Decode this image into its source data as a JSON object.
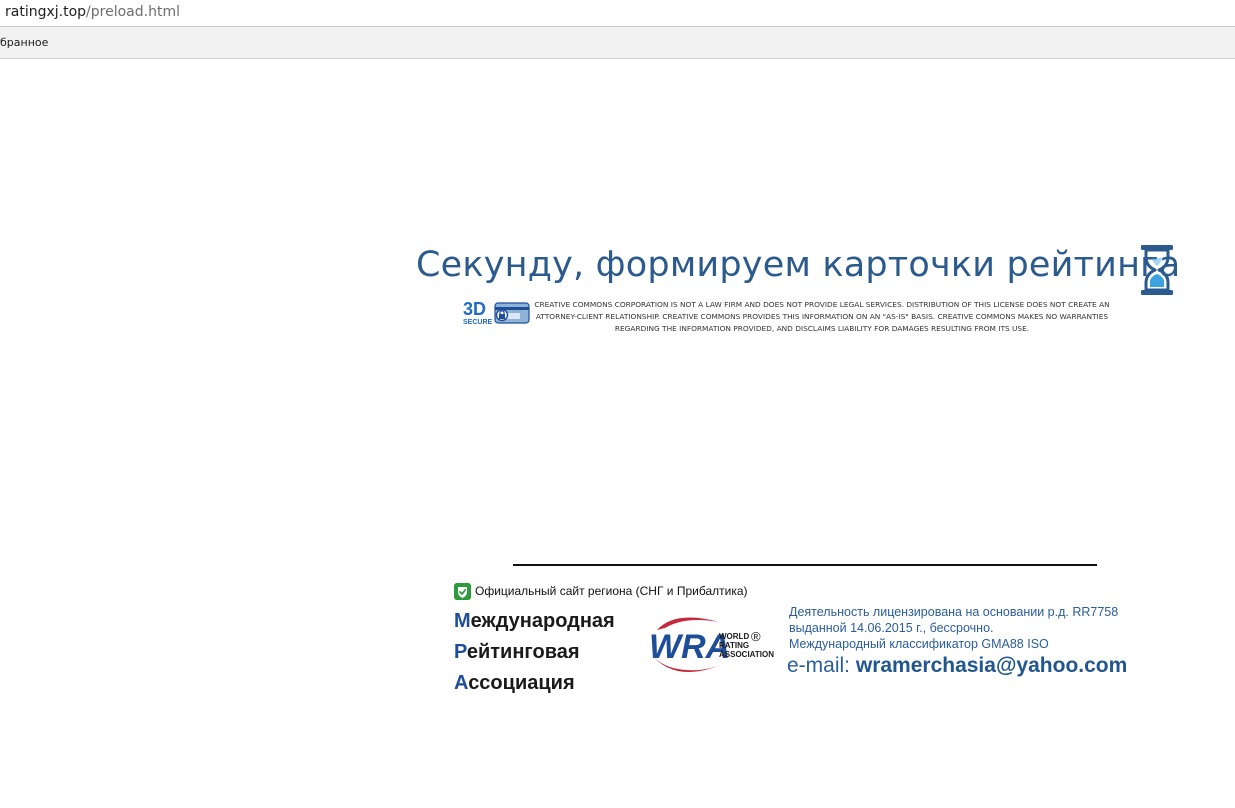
{
  "browser": {
    "url_host": "ratingxj.top",
    "url_path": "/preload.html",
    "bookmarks_label": "бранное"
  },
  "loading": {
    "title": "Секунду, формируем карточки рейтинга",
    "icon": "hourglass-icon"
  },
  "secure_badge": {
    "big": "3D",
    "small": "SECURE"
  },
  "disclaimer": "CREATIVE COMMONS CORPORATION IS NOT A LAW FIRM AND DOES NOT PROVIDE LEGAL SERVICES. DISTRIBUTION OF THIS LICENSE DOES NOT CREATE AN ATTORNEY-CLIENT RELATIONSHIP. CREATIVE COMMONS PROVIDES THIS INFORMATION ON AN \"AS-IS\" BASIS. CREATIVE COMMONS MAKES NO WARRANTIES REGARDING THE INFORMATION PROVIDED, AND DISCLAIMS LIABILITY FOR DAMAGES RESULTING FROM ITS USE.",
  "footer": {
    "official_text": "Официальный сайт региона (СНГ и Прибалтика)",
    "assoc": {
      "line1_first": "М",
      "line1_rest": "еждународная",
      "line2_first": "Р",
      "line2_rest": "ейтинговая",
      "line3_first": "А",
      "line3_rest": "ссоциация"
    },
    "wra": {
      "letters": "WRA",
      "line1": "WORLD",
      "line2": "RATING",
      "line3": "ASSOCIATION",
      "reg": "®"
    },
    "license_line1": "Деятельность лицензирована на основании р.д. RR7758",
    "license_line2": "выданной 14.06.2015 г., бессрочно.",
    "license_line3": "Международный классификатор GMA88 ISO",
    "email_label": "e-mail:",
    "email": "wramerchasia@yahoo.com"
  },
  "colors": {
    "title": "#2b5b8e",
    "accent_blue": "#1f4e98",
    "wra_red": "#c8283c",
    "check_green": "#2e9a3e"
  }
}
